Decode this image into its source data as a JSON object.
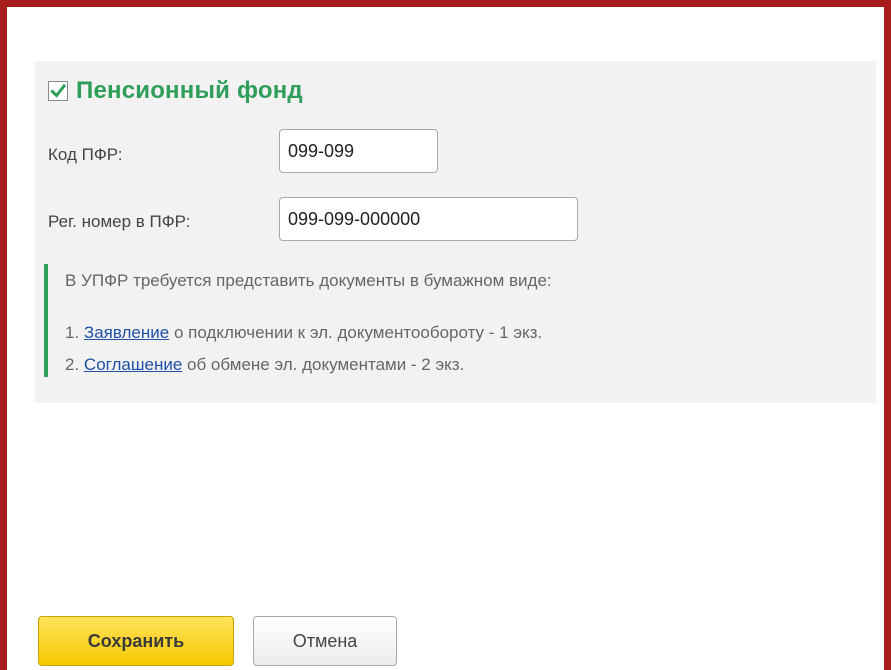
{
  "section": {
    "title": "Пенсионный фонд",
    "checked": true
  },
  "fields": {
    "pfr_code": {
      "label": "Код ПФР:",
      "value": "099-099"
    },
    "reg_number": {
      "label": "Рег. номер в ПФР:",
      "value": "099-099-000000"
    }
  },
  "note": {
    "intro": "В УПФР требуется представить документы в бумажном виде:",
    "items": [
      {
        "number": "1.",
        "link": "Заявление",
        "text": " о подключении к эл. документообороту - 1 экз."
      },
      {
        "number": "2.",
        "link": "Соглашение",
        "text": " об обмене эл. документами  - 2 экз."
      }
    ]
  },
  "buttons": {
    "save_label": "Сохранить",
    "cancel_label": "Отмена"
  },
  "colors": {
    "frame": "#a81c1c",
    "accent_green": "#2f9e5a",
    "link_blue": "#1f4fa6",
    "save_yellow": "#f5c800"
  },
  "icons": {
    "checkbox": "checkmark-icon"
  }
}
